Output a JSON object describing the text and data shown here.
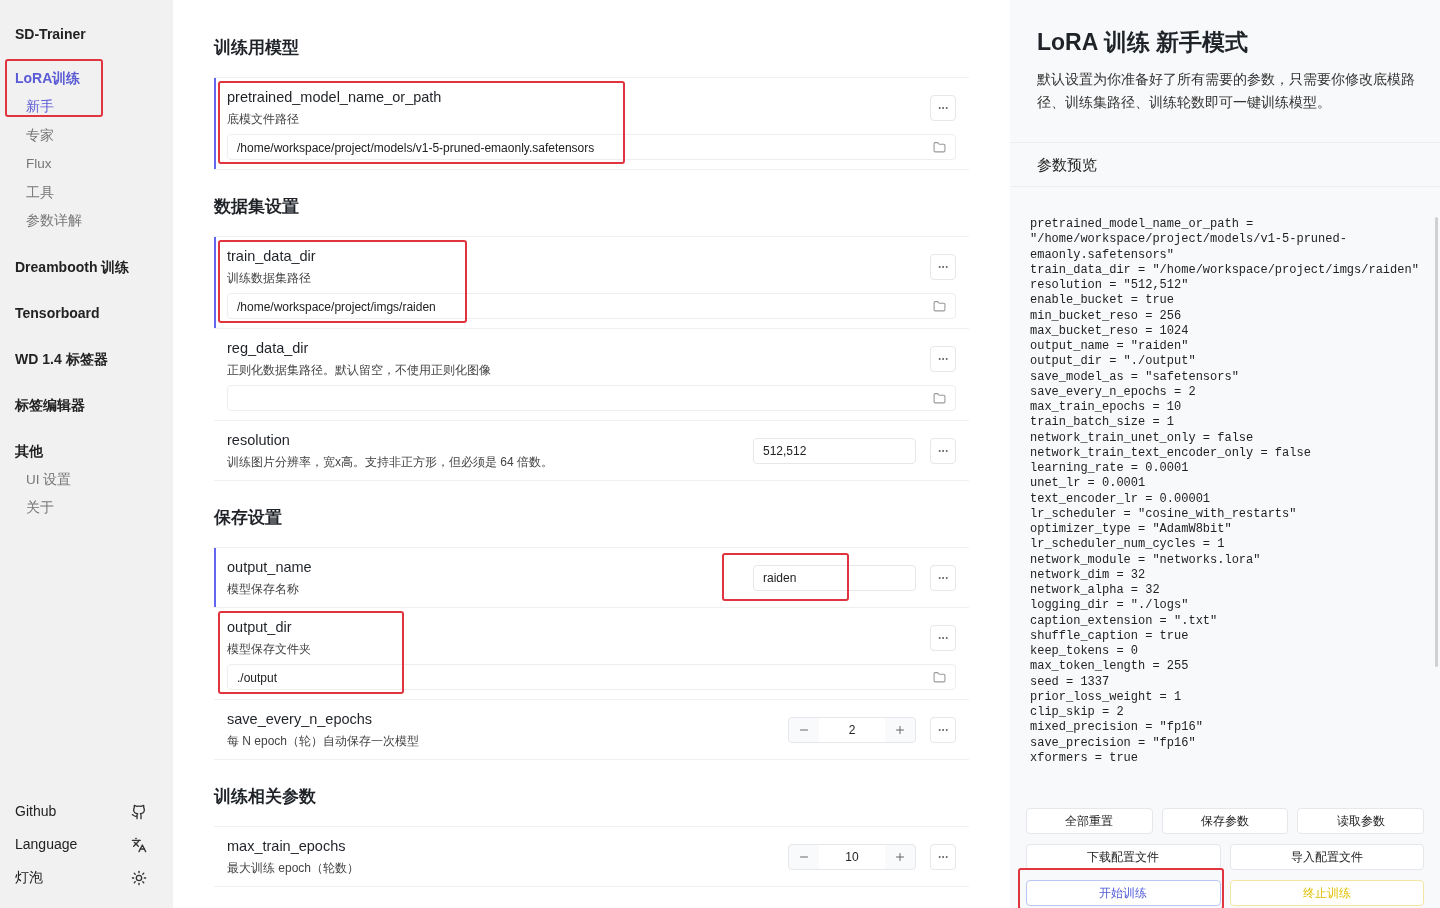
{
  "sidebar": {
    "title": "SD-Trainer",
    "groups": [
      {
        "label": "LoRA训练",
        "selected": true,
        "annotated": true,
        "children": [
          {
            "label": "新手",
            "selected": true
          },
          {
            "label": "专家",
            "selected": false
          },
          {
            "label": "Flux",
            "selected": false
          },
          {
            "label": "工具",
            "selected": false
          },
          {
            "label": "参数详解",
            "selected": false
          }
        ]
      },
      {
        "label": "Dreambooth 训练",
        "selected": false,
        "annotated": false
      },
      {
        "label": "Tensorboard",
        "selected": false,
        "annotated": false
      },
      {
        "label": "WD 1.4 标签器",
        "selected": false,
        "annotated": false
      },
      {
        "label": "标签编辑器",
        "selected": false,
        "annotated": false
      },
      {
        "label": "其他",
        "selected": false,
        "annotated": false,
        "children": [
          {
            "label": "UI 设置",
            "selected": false
          },
          {
            "label": "关于",
            "selected": false
          }
        ]
      }
    ],
    "footer": [
      {
        "label": "Github",
        "kind": "github"
      },
      {
        "label": "Language",
        "kind": "language"
      },
      {
        "label": "灯泡",
        "kind": "theme"
      }
    ]
  },
  "sections": [
    {
      "title": "训练用模型",
      "rows": [
        {
          "kind": "path",
          "name": "pretrained_model_name_or_path",
          "description": "底模文件路径",
          "value": "/home/workspace/project/models/v1-5-pruned-emaonly.safetensors",
          "active": true,
          "annotated": true
        }
      ]
    },
    {
      "title": "数据集设置",
      "rows": [
        {
          "kind": "path",
          "name": "train_data_dir",
          "description": "训练数据集路径",
          "value": "/home/workspace/project/imgs/raiden",
          "active": true,
          "annotated": true
        },
        {
          "kind": "path",
          "name": "reg_data_dir",
          "description": "正则化数据集路径。默认留空，不使用正则化图像",
          "active": false,
          "annotated": false
        },
        {
          "kind": "text",
          "name": "resolution",
          "description": "训练图片分辨率，宽x高。支持非正方形，但必须是 64 倍数。",
          "value": "512,512",
          "active": false,
          "annotated": false
        }
      ]
    },
    {
      "title": "保存设置",
      "rows": [
        {
          "kind": "text",
          "name": "output_name",
          "description": "模型保存名称",
          "value": "raiden",
          "active": true,
          "annotated": true
        },
        {
          "kind": "path",
          "name": "output_dir",
          "description": "模型保存文件夹",
          "value": "./output",
          "active": false,
          "annotated": true
        },
        {
          "kind": "number",
          "name": "save_every_n_epochs",
          "description": "每 N epoch（轮）自动保存一次模型",
          "value": "2",
          "active": false,
          "annotated": false
        }
      ]
    },
    {
      "title": "训练相关参数",
      "rows": [
        {
          "kind": "number",
          "name": "max_train_epochs",
          "description": "最大训练 epoch（轮数）",
          "value": "10",
          "active": false,
          "annotated": false
        }
      ]
    }
  ],
  "panel": {
    "title": "LoRA 训练 新手模式",
    "description": "默认设置为你准备好了所有需要的参数，只需要你修改底模路径、训练集路径、训练轮数即可一键训练模型。",
    "preview_title": "参数预览",
    "preview_lines": [
      "pretrained_model_name_or_path = \"/home/workspace/project/models/v1-5-pruned-emaonly.safetensors\"",
      "train_data_dir = \"/home/workspace/project/imgs/raiden\"",
      "resolution = \"512,512\"",
      "enable_bucket = true",
      "min_bucket_reso = 256",
      "max_bucket_reso = 1024",
      "output_name = \"raiden\"",
      "output_dir = \"./output\"",
      "save_model_as = \"safetensors\"",
      "save_every_n_epochs = 2",
      "max_train_epochs = 10",
      "train_batch_size = 1",
      "network_train_unet_only = false",
      "network_train_text_encoder_only = false",
      "learning_rate = 0.0001",
      "unet_lr = 0.0001",
      "text_encoder_lr = 0.00001",
      "lr_scheduler = \"cosine_with_restarts\"",
      "optimizer_type = \"AdamW8bit\"",
      "lr_scheduler_num_cycles = 1",
      "network_module = \"networks.lora\"",
      "network_dim = 32",
      "network_alpha = 32",
      "logging_dir = \"./logs\"",
      "caption_extension = \".txt\"",
      "shuffle_caption = true",
      "keep_tokens = 0",
      "max_token_length = 255",
      "seed = 1337",
      "prior_loss_weight = 1",
      "clip_skip = 2",
      "mixed_precision = \"fp16\"",
      "save_precision = \"fp16\"",
      "xformers = true"
    ],
    "button_rows": [
      [
        {
          "label": "全部重置",
          "kind": "plain",
          "annotated": false
        },
        {
          "label": "保存参数",
          "kind": "plain",
          "annotated": false
        },
        {
          "label": "读取参数",
          "kind": "plain",
          "annotated": false
        }
      ],
      [
        {
          "label": "下载配置文件",
          "kind": "plain",
          "annotated": false
        },
        {
          "label": "导入配置文件",
          "kind": "plain",
          "annotated": false
        }
      ],
      [
        {
          "label": "开始训练",
          "kind": "primary",
          "annotated": true
        },
        {
          "label": "终止训练",
          "kind": "warning",
          "annotated": false
        }
      ]
    ]
  }
}
